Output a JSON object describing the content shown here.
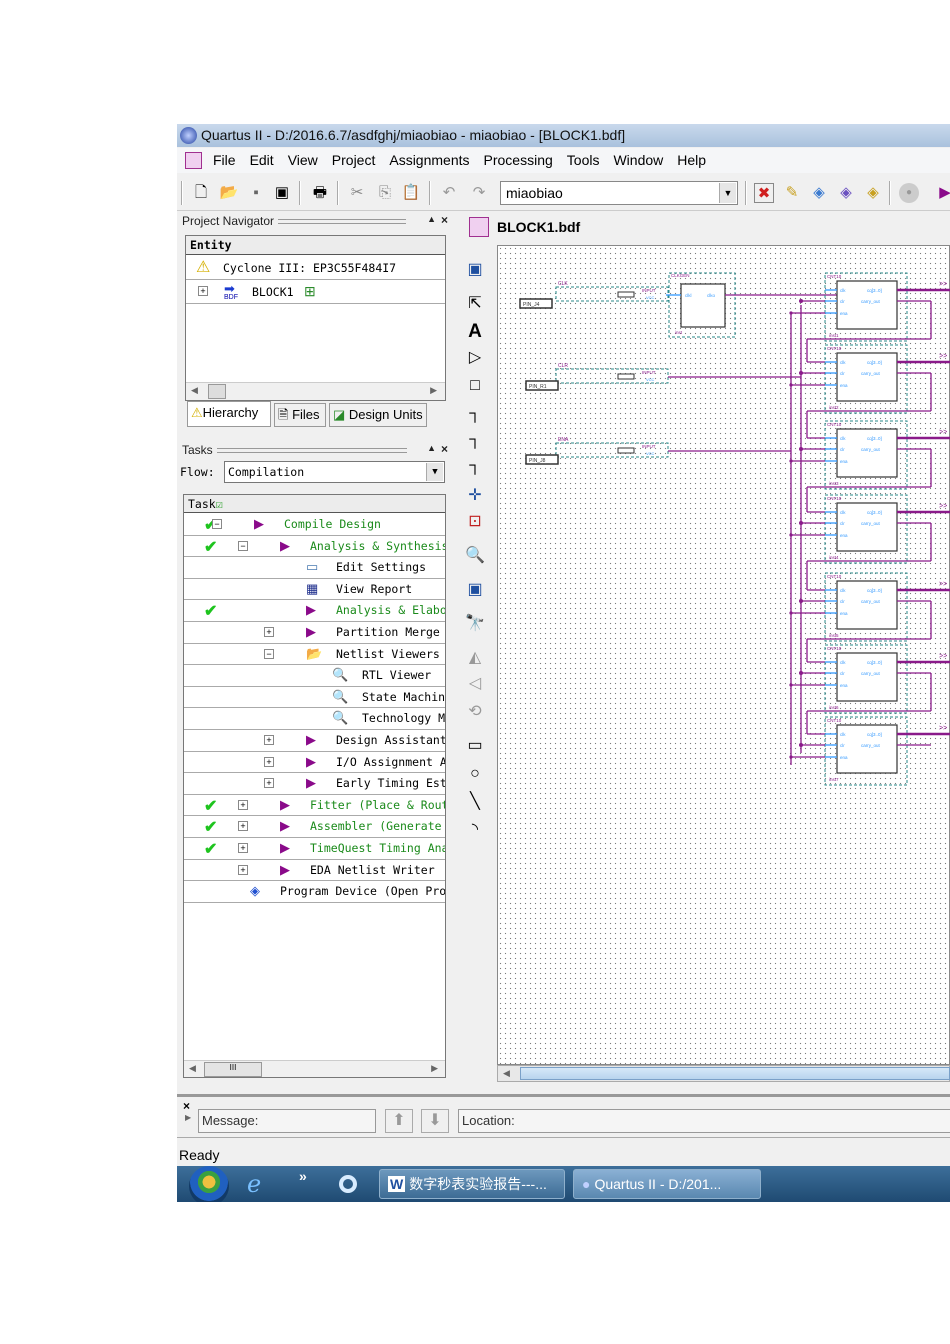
{
  "window": {
    "title": "Quartus II - D:/2016.6.7/asdfghj/miaobiao - miaobiao - [BLOCK1.bdf]"
  },
  "menu": [
    "File",
    "Edit",
    "View",
    "Project",
    "Assignments",
    "Processing",
    "Tools",
    "Window",
    "Help"
  ],
  "toolbar": {
    "project_combo": "miaobiao"
  },
  "navigator": {
    "title": "Project Navigator",
    "column": "Entity",
    "device": "Cyclone III: EP3C55F484I7",
    "top_entity": "BLOCK1",
    "bdf_badge": "BDF",
    "tabs": [
      "Hierarchy",
      "Files",
      "Design Units"
    ]
  },
  "tasks": {
    "title": "Tasks",
    "flow_label": "Flow:",
    "flow_value": "Compilation",
    "column": "Task",
    "rows": [
      {
        "label": "Compile Design",
        "done": true,
        "level": 0,
        "icon": "play-icon",
        "expander": "-"
      },
      {
        "label": "Analysis & Synthesis",
        "done": true,
        "level": 1,
        "icon": "play-icon",
        "expander": "-"
      },
      {
        "label": "Edit Settings",
        "done": false,
        "level": 2,
        "icon": "window-icon",
        "expander": ""
      },
      {
        "label": "View Report",
        "done": false,
        "level": 2,
        "icon": "table-icon",
        "expander": ""
      },
      {
        "label": "Analysis & Elaboration",
        "done": true,
        "level": 2,
        "icon": "play-icon",
        "expander": ""
      },
      {
        "label": "Partition Merge",
        "done": false,
        "level": 2,
        "icon": "play-icon",
        "expander": "+"
      },
      {
        "label": "Netlist Viewers",
        "done": false,
        "level": 2,
        "icon": "folder-icon",
        "expander": "-"
      },
      {
        "label": "RTL Viewer",
        "done": false,
        "level": 3,
        "icon": "magnifier-icon",
        "expander": ""
      },
      {
        "label": "State Machine Viewer",
        "done": false,
        "level": 3,
        "icon": "magnifier-icon",
        "expander": ""
      },
      {
        "label": "Technology Map Viewer",
        "done": false,
        "level": 3,
        "icon": "magnifier-icon",
        "expander": ""
      },
      {
        "label": "Design Assistant",
        "done": false,
        "level": 2,
        "icon": "play-icon",
        "expander": "+"
      },
      {
        "label": "I/O Assignment Analysis",
        "done": false,
        "level": 2,
        "icon": "play-icon",
        "expander": "+"
      },
      {
        "label": "Early Timing Estimate",
        "done": false,
        "level": 2,
        "icon": "play-icon",
        "expander": "+"
      },
      {
        "label": "Fitter (Place & Route)",
        "done": true,
        "level": 1,
        "icon": "play-icon",
        "expander": "+"
      },
      {
        "label": "Assembler (Generate programming files)",
        "done": true,
        "level": 1,
        "icon": "play-icon",
        "expander": "+"
      },
      {
        "label": "TimeQuest Timing Analysis",
        "done": true,
        "level": 1,
        "icon": "play-icon",
        "expander": "+"
      },
      {
        "label": "EDA Netlist Writer",
        "done": false,
        "level": 1,
        "icon": "play-icon",
        "expander": "+"
      },
      {
        "label": "Program Device (Open Programmer)",
        "done": false,
        "level": 0,
        "icon": "programmer-icon",
        "expander": ""
      }
    ]
  },
  "editor": {
    "tab_title": "BLOCK1.bdf",
    "pins": [
      {
        "signal": "CLK",
        "location": "PIN_J4",
        "type": "INPUT",
        "std": "VCC"
      },
      {
        "signal": "CLR",
        "location": "PIN_R1",
        "type": "INPUT",
        "std": "VCC"
      },
      {
        "signal": "ENA",
        "location": "PIN_J8",
        "type": "INPUT",
        "std": "VCC"
      }
    ],
    "clkgen": {
      "name": "CLKGEN",
      "inst": "inst",
      "in": "clkl",
      "out": "clko"
    },
    "counters": {
      "name": "CNT10",
      "ports": [
        "clk",
        "clr",
        "ena",
        "cq[3..0]",
        "carry_out"
      ],
      "instances": [
        "inst1",
        "inst2",
        "inst3",
        "inst4",
        "inst5",
        "inst6",
        "inst7"
      ]
    }
  },
  "messages": {
    "message_label": "Message:",
    "location_label": "Location:"
  },
  "status": "Ready",
  "taskbar": {
    "items": [
      "数字秒表实验报告---...",
      "Quartus II - D:/201..."
    ]
  },
  "colors": {
    "wire": "#8a1a8a",
    "port": "#3399ff",
    "instance_border": "#2a8a8a"
  }
}
